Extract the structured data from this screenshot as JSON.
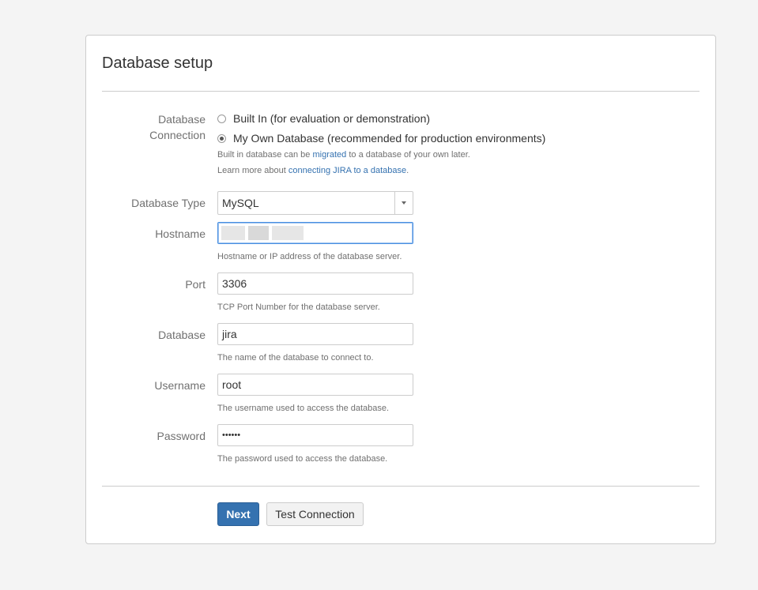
{
  "page": {
    "title": "Database setup"
  },
  "connection": {
    "label": "Database Connection",
    "label_line1": "Database",
    "label_line2": "Connection",
    "options": [
      {
        "label": "Built In (for evaluation or demonstration)",
        "selected": false
      },
      {
        "label": "My Own Database (recommended for production environments)",
        "selected": true
      }
    ],
    "help1_prefix": "Built in database can be ",
    "help1_link": "migrated",
    "help1_suffix": " to a database of your own later.",
    "help2_prefix": "Learn more about ",
    "help2_link": "connecting JIRA to a database",
    "help2_suffix": "."
  },
  "db_type": {
    "label": "Database Type",
    "value": "MySQL"
  },
  "hostname": {
    "label": "Hostname",
    "value": "",
    "help": "Hostname or IP address of the database server."
  },
  "port": {
    "label": "Port",
    "value": "3306",
    "help": "TCP Port Number for the database server."
  },
  "database": {
    "label": "Database",
    "value": "jira",
    "help": "The name of the database to connect to."
  },
  "username": {
    "label": "Username",
    "value": "root",
    "help": "The username used to access the database."
  },
  "password": {
    "label": "Password",
    "value": "••••••",
    "help": "The password used to access the database."
  },
  "buttons": {
    "next": "Next",
    "test": "Test Connection"
  },
  "colors": {
    "primary": "#3572b0",
    "link": "#3572b0",
    "focus": "#4a90e2"
  }
}
